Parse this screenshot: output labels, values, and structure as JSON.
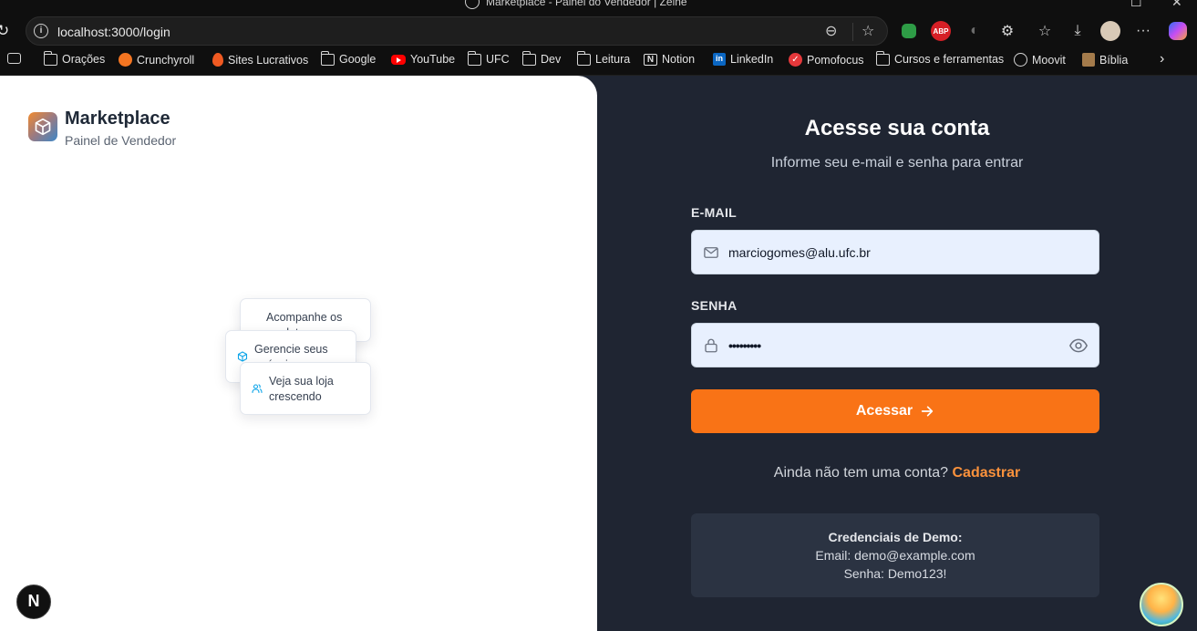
{
  "browser": {
    "window_title": "Marketplace - Painel do Vendedor | Zeine",
    "url": "localhost:3000/login",
    "bookmarks": [
      {
        "label": "Orações",
        "icon": "folder-icon"
      },
      {
        "label": "Crunchyroll",
        "icon": "crunchyroll-icon"
      },
      {
        "label": "Sites Lucrativos",
        "icon": "fire-icon"
      },
      {
        "label": "Google",
        "icon": "folder-icon"
      },
      {
        "label": "YouTube",
        "icon": "youtube-icon"
      },
      {
        "label": "UFC",
        "icon": "folder-icon"
      },
      {
        "label": "Dev",
        "icon": "folder-icon"
      },
      {
        "label": "Leitura",
        "icon": "folder-icon"
      },
      {
        "label": "Notion",
        "icon": "notion-icon"
      },
      {
        "label": "LinkedIn",
        "icon": "linkedin-icon"
      },
      {
        "label": "Pomofocus",
        "icon": "pomofocus-icon"
      },
      {
        "label": "Cursos e ferramentas",
        "icon": "folder-icon"
      },
      {
        "label": "Moovit",
        "icon": "globe-icon"
      },
      {
        "label": "Bíblia",
        "icon": "biblia-icon"
      }
    ],
    "abp_label": "ABP",
    "more_label": "···"
  },
  "brand": {
    "name": "Marketplace",
    "subtitle": "Painel de Vendedor"
  },
  "feature_cards": [
    {
      "text": "Acompanhe os produtos",
      "icon": "chart-icon"
    },
    {
      "text": "Gerencie seus anúncios",
      "icon": "box-icon"
    },
    {
      "text": "Veja sua loja crescendo",
      "icon": "users-icon"
    }
  ],
  "next_badge": "N",
  "login": {
    "title": "Acesse sua conta",
    "subtitle": "Informe seu e-mail e senha para entrar",
    "email_label": "E-MAIL",
    "email_value": "marciogomes@alu.ufc.br",
    "password_label": "SENHA",
    "password_value": "•••••••••",
    "submit_label": "Acessar",
    "signup_prompt": "Ainda não tem uma conta?",
    "signup_link": "Cadastrar",
    "demo_title": "Credenciais de Demo:",
    "demo_email": "Email: demo@example.com",
    "demo_password": "Senha: Demo123!"
  },
  "colors": {
    "accent": "#f97316",
    "link": "#fb923c",
    "background": "#1f2532",
    "input_bg": "#e8f0fe"
  }
}
